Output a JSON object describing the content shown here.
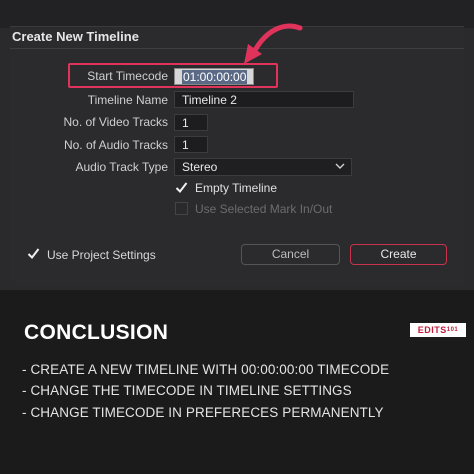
{
  "dialog": {
    "title": "Create New Timeline",
    "start_timecode_label": "Start Timecode",
    "start_timecode_value": "01:00:00:00",
    "timeline_name_label": "Timeline Name",
    "timeline_name_value": "Timeline 2",
    "video_tracks_label": "No. of Video Tracks",
    "video_tracks_value": "1",
    "audio_tracks_label": "No. of Audio Tracks",
    "audio_tracks_value": "1",
    "audio_type_label": "Audio Track Type",
    "audio_type_value": "Stereo",
    "empty_timeline_label": "Empty Timeline",
    "use_marks_label": "Use Selected Mark In/Out",
    "use_project_label": "Use Project Settings",
    "cancel_label": "Cancel",
    "create_label": "Create"
  },
  "annotation": {
    "highlight_color": "#e0335b"
  },
  "conclusion": {
    "heading": "CONCLUSION",
    "logo_text": "EDITS",
    "logo_num": "101",
    "points": [
      "- CREATE A NEW TIMELINE WITH 00:00:00:00 TIMECODE",
      "- CHANGE THE TIMECODE IN TIMELINE SETTINGS",
      "- CHANGE TIMECODE IN PREFERECES PERMANENTLY"
    ]
  }
}
